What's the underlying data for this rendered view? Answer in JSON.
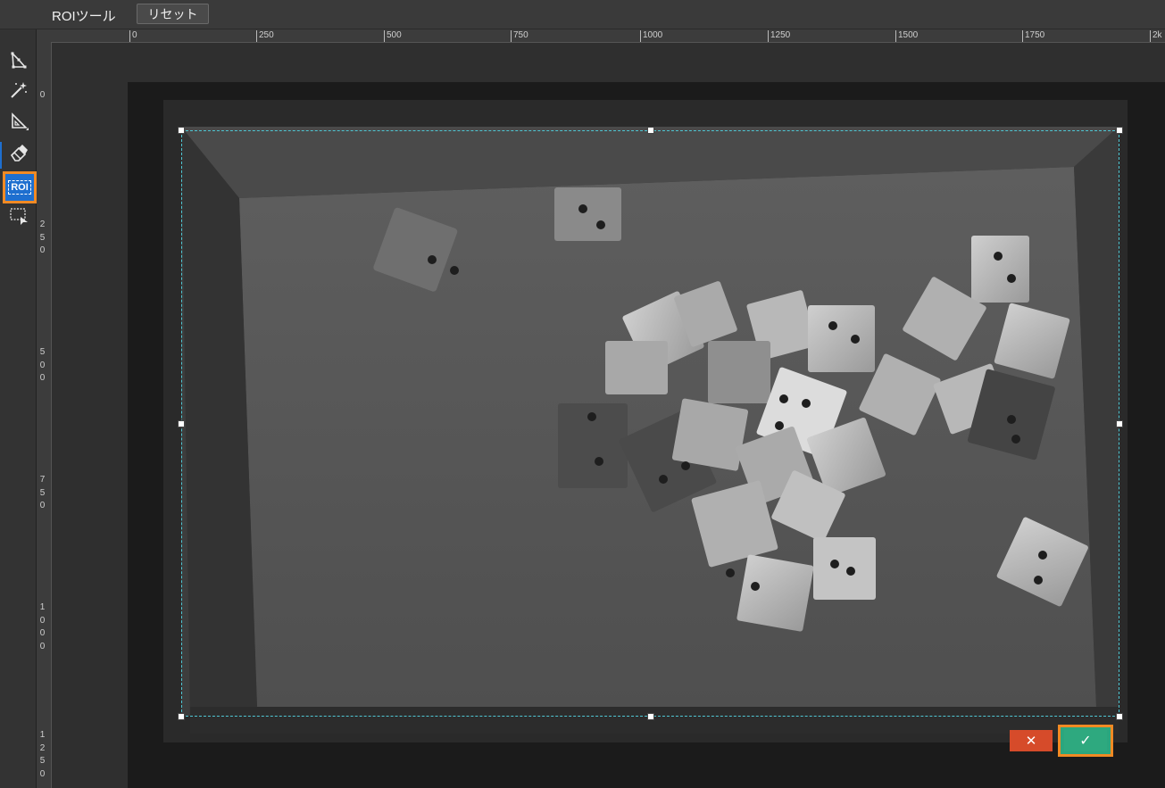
{
  "header": {
    "tool_title": "ROIツール",
    "reset_label": "リセット"
  },
  "toolbar": {
    "items": [
      {
        "name": "polygon-tool",
        "icon": "polygon-icon"
      },
      {
        "name": "magic-wand-tool",
        "icon": "magic-wand-icon"
      },
      {
        "name": "triangle-ruler-tool",
        "icon": "triangle-ruler-icon"
      },
      {
        "name": "eraser-tool",
        "icon": "eraser-icon"
      },
      {
        "name": "roi-tool",
        "icon": "roi-icon",
        "label": "ROI",
        "active": true
      },
      {
        "name": "region-select-tool",
        "icon": "rect-select-arrow-icon"
      }
    ]
  },
  "ruler": {
    "horizontal": [
      "0",
      "250",
      "500",
      "750",
      "1000",
      "1250",
      "1500",
      "1750",
      "2k"
    ],
    "vertical": [
      "0",
      "250",
      "500",
      "750",
      "1000",
      "1250"
    ]
  },
  "actions": {
    "cancel_symbol": "✕",
    "confirm_symbol": "✓"
  },
  "colors": {
    "accent_blue": "#1e6fcf",
    "highlight_orange": "#f08a24",
    "cancel_red": "#d64b2a",
    "confirm_green": "#2ba67e",
    "roi_border": "#4fc7d4"
  }
}
